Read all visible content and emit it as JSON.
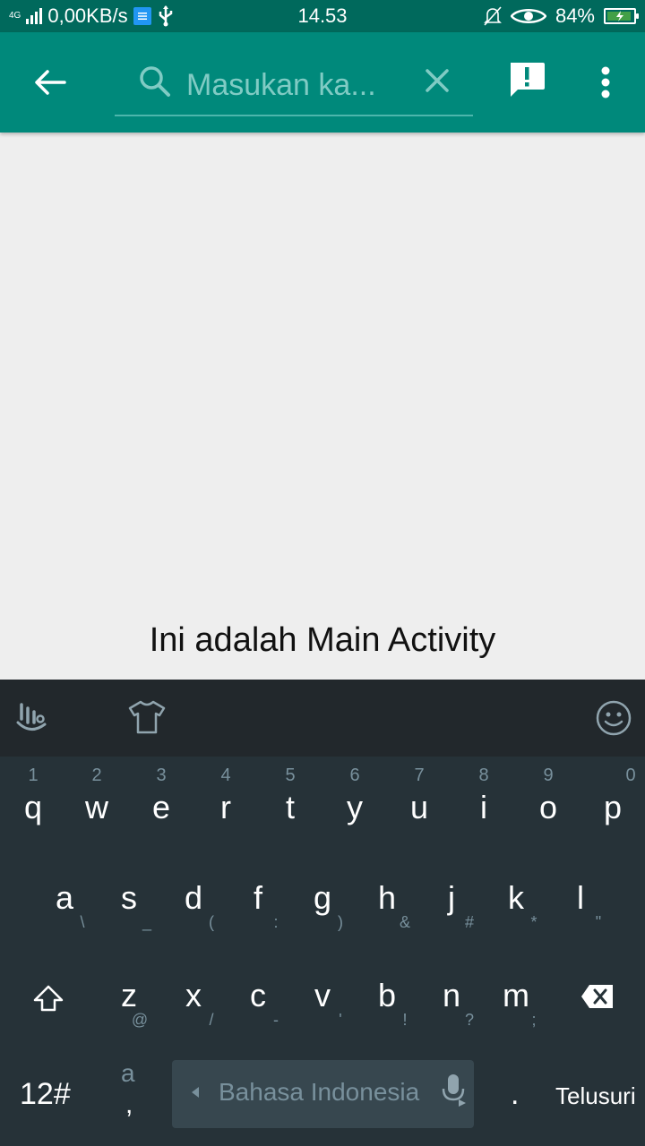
{
  "status_bar": {
    "network": "4G",
    "data_speed": "0,00KB/s",
    "time": "14.53",
    "battery": "84%"
  },
  "toolbar": {
    "search_placeholder": "Masukan ka..."
  },
  "main": {
    "text": "Ini adalah Main Activity"
  },
  "keyboard": {
    "row1": [
      {
        "key": "q",
        "hint": "1"
      },
      {
        "key": "w",
        "hint": "2"
      },
      {
        "key": "e",
        "hint": "3"
      },
      {
        "key": "r",
        "hint": "4"
      },
      {
        "key": "t",
        "hint": "5"
      },
      {
        "key": "y",
        "hint": "6"
      },
      {
        "key": "u",
        "hint": "7"
      },
      {
        "key": "i",
        "hint": "8"
      },
      {
        "key": "o",
        "hint": "9"
      },
      {
        "key": "p",
        "hint": "0"
      }
    ],
    "row2": [
      {
        "key": "a",
        "hint": "\\"
      },
      {
        "key": "s",
        "hint": "_"
      },
      {
        "key": "d",
        "hint": "("
      },
      {
        "key": "f",
        "hint": ":"
      },
      {
        "key": "g",
        "hint": ")"
      },
      {
        "key": "h",
        "hint": "&"
      },
      {
        "key": "j",
        "hint": "#"
      },
      {
        "key": "k",
        "hint": "*"
      },
      {
        "key": "l",
        "hint": "\""
      }
    ],
    "row3": [
      {
        "key": "z",
        "hint": "@"
      },
      {
        "key": "x",
        "hint": "/"
      },
      {
        "key": "c",
        "hint": "-"
      },
      {
        "key": "v",
        "hint": "'"
      },
      {
        "key": "b",
        "hint": "!"
      },
      {
        "key": "n",
        "hint": "?"
      },
      {
        "key": "m",
        "hint": ";"
      }
    ],
    "bottom": {
      "symbols": "12#",
      "comma_top": "a",
      "comma": ",",
      "language": "Bahasa Indonesia",
      "period": ".",
      "action": "Telusuri"
    }
  }
}
